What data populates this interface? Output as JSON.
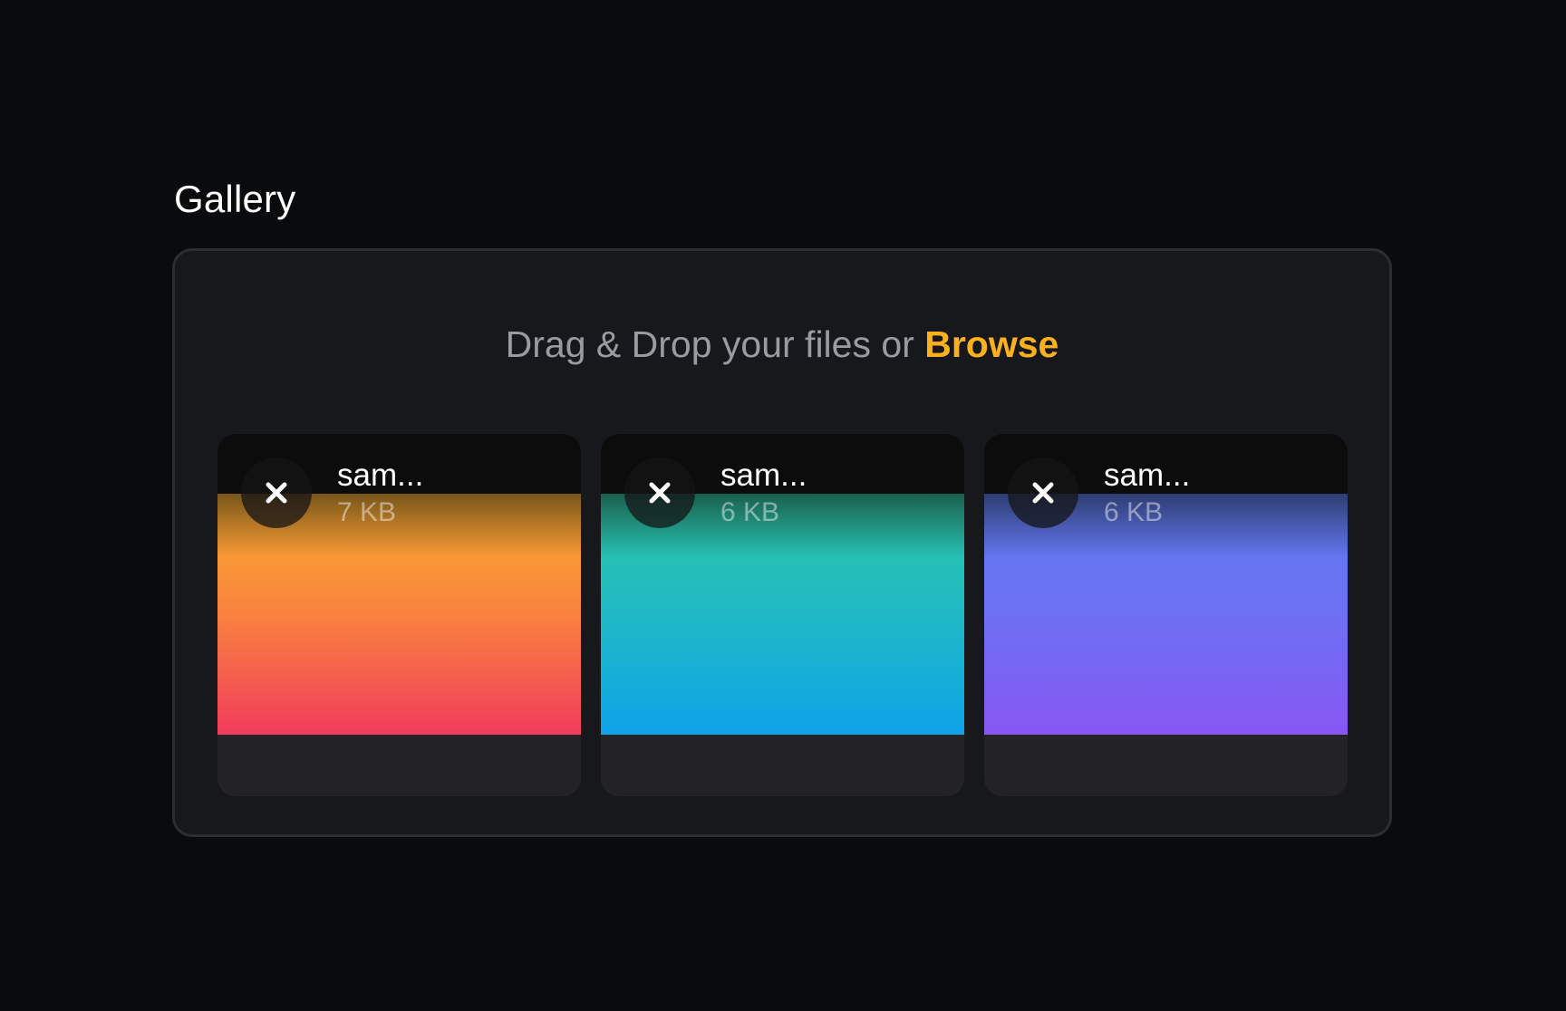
{
  "gallery": {
    "label": "Gallery"
  },
  "dropzone": {
    "prompt": "Drag & Drop your files or ",
    "browse_label": "Browse",
    "accent_color": "#fbb01d"
  },
  "files": [
    {
      "name": "sam...",
      "size": "7 KB",
      "remove_icon": "close-icon",
      "preview": "orange-gradient"
    },
    {
      "name": "sam...",
      "size": "6 KB",
      "remove_icon": "close-icon",
      "preview": "teal-gradient"
    },
    {
      "name": "sam...",
      "size": "6 KB",
      "remove_icon": "close-icon",
      "preview": "purple-gradient"
    }
  ]
}
